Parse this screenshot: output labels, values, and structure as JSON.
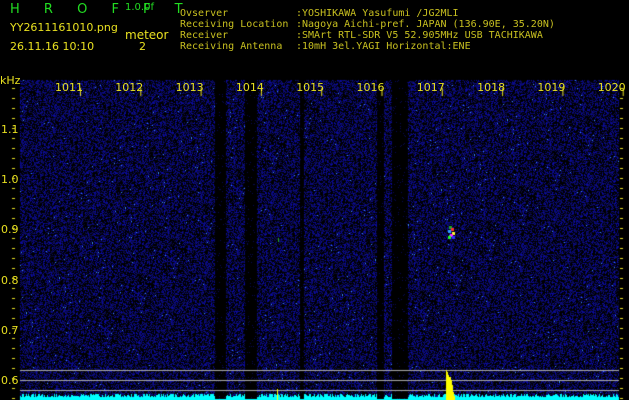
{
  "header": {
    "app": "H R O F F T",
    "version": "1.0.0f",
    "filename": "YY2611161010.png",
    "datetime": "26.11.16 10:10",
    "type_label": "meteor",
    "count": "2"
  },
  "info": [
    {
      "label": "Ovserver",
      "value": ":YOSHIKAWA Yasufumi /JG2MLI"
    },
    {
      "label": "Receiving Location",
      "value": ":Nagoya Aichi-pref. JAPAN (136.90E, 35.20N)"
    },
    {
      "label": "Receiver",
      "value": ":SMArt RTL-SDR V5 52.905MHz USB TACHIKAWA"
    },
    {
      "label": "Receiving Antenna",
      "value": ":10mH 3el.YAGI Horizontal:ENE"
    }
  ],
  "axis": {
    "unit": "kHz",
    "x_labels": [
      "1011",
      "1012",
      "1013",
      "1014",
      "1015",
      "1016",
      "1017",
      "1018",
      "1019",
      "1020"
    ],
    "y_labels": [
      "1.1",
      "1.0",
      "0.9",
      "0.8",
      "0.7",
      "0.6"
    ]
  },
  "colors": {
    "noise": "#1a1acc",
    "histogram": "#00ffff",
    "spike": "#ffff00",
    "text": "#e8e020"
  }
}
